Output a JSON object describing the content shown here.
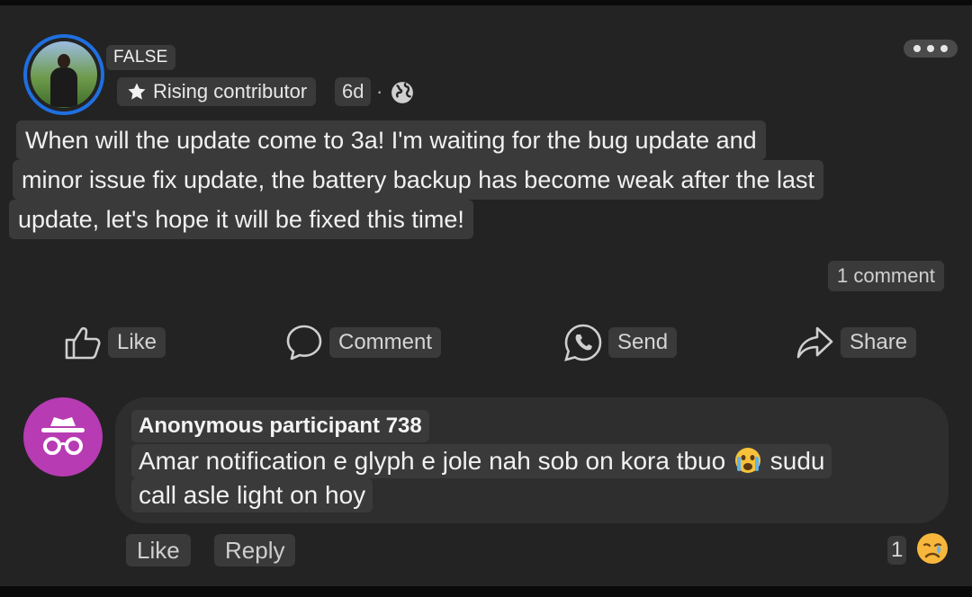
{
  "post": {
    "author": "FALSE",
    "badge": "Rising contributor",
    "time": "6d",
    "separator": "·",
    "lines": [
      "When will the update come to 3a! I'm waiting for the bug update and",
      "minor issue fix update, the battery backup has become weak after the last",
      "update, let's hope it will be fixed this time!"
    ],
    "comment_count": "1 comment"
  },
  "actions": {
    "like": "Like",
    "comment": "Comment",
    "send": "Send",
    "share": "Share"
  },
  "comment": {
    "author": "Anonymous participant 738",
    "line1_a": "Amar notification e glyph e jole nah sob on kora tbuo",
    "line1_b": "sudu",
    "line2": "call asle light on hoy",
    "like": "Like",
    "reply": "Reply",
    "reaction_count": "1"
  },
  "colors": {
    "accent_ring": "#1f6fe0",
    "anon_avatar": "#b73bb3",
    "background": "#232323"
  },
  "icons": [
    "star-icon",
    "globe-icon",
    "more-icon",
    "like-icon",
    "comment-icon",
    "send-icon",
    "share-icon",
    "incognito-icon",
    "crying-emoji-icon",
    "sad-emoji-icon"
  ]
}
